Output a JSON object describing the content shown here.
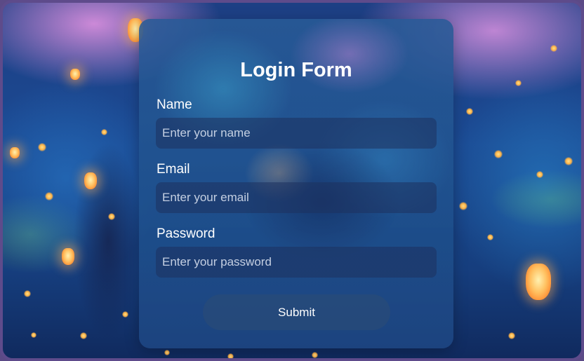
{
  "form": {
    "title": "Login Form",
    "fields": [
      {
        "label": "Name",
        "placeholder": "Enter your name",
        "value": ""
      },
      {
        "label": "Email",
        "placeholder": "Enter your email",
        "value": ""
      },
      {
        "label": "Password",
        "placeholder": "Enter your password",
        "value": ""
      }
    ],
    "submit_label": "Submit"
  },
  "colors": {
    "frame_border": "#5e4b8b",
    "text": "#ffffff",
    "background_night": "#1b4a93",
    "lantern_glow": "#ffc060"
  }
}
